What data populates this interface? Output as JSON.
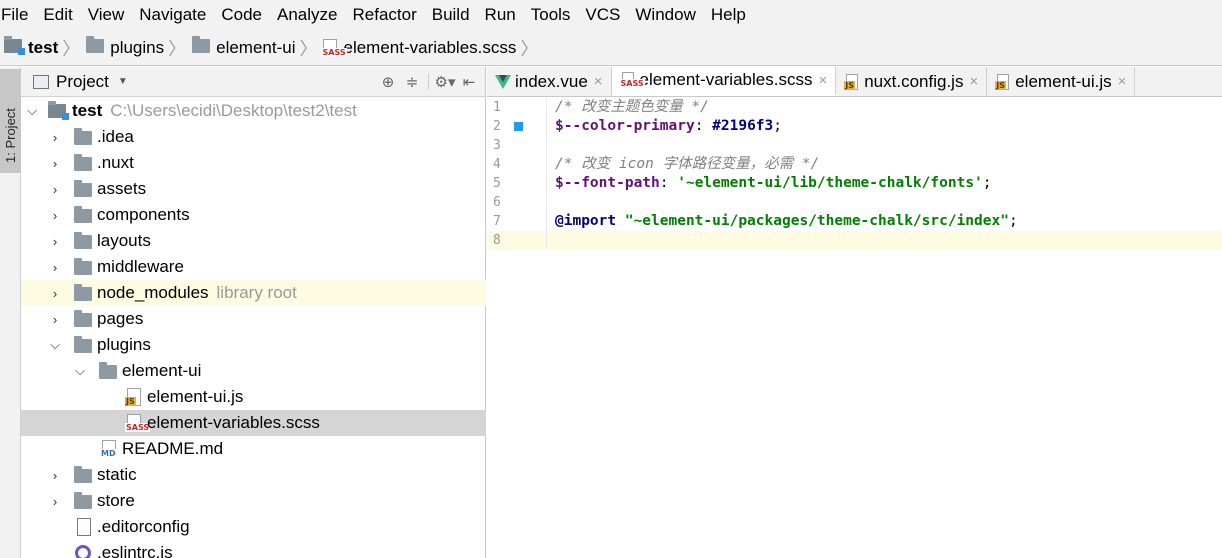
{
  "menu": [
    "File",
    "Edit",
    "View",
    "Navigate",
    "Code",
    "Analyze",
    "Refactor",
    "Build",
    "Run",
    "Tools",
    "VCS",
    "Window",
    "Help"
  ],
  "breadcrumb": [
    "test",
    "plugins",
    "element-ui",
    "element-variables.scss"
  ],
  "toolstrip": {
    "project_tab": "1: Project"
  },
  "panel": {
    "title": "Project"
  },
  "tree": [
    {
      "label": "test",
      "note": "C:\\Users\\ecidi\\Desktop\\test2\\test"
    },
    {
      "label": ".idea"
    },
    {
      "label": ".nuxt"
    },
    {
      "label": "assets"
    },
    {
      "label": "components"
    },
    {
      "label": "layouts"
    },
    {
      "label": "middleware"
    },
    {
      "label": "node_modules",
      "note": "library root"
    },
    {
      "label": "pages"
    },
    {
      "label": "plugins"
    },
    {
      "label": "element-ui"
    },
    {
      "label": "element-ui.js"
    },
    {
      "label": "element-variables.scss"
    },
    {
      "label": "README.md"
    },
    {
      "label": "static"
    },
    {
      "label": "store"
    },
    {
      "label": ".editorconfig"
    },
    {
      "label": ".eslintrc.js"
    }
  ],
  "tabs": [
    {
      "label": "index.vue"
    },
    {
      "label": "element-variables.scss"
    },
    {
      "label": "nuxt.config.js"
    },
    {
      "label": "element-ui.js"
    }
  ],
  "code": {
    "line_numbers": [
      "1",
      "2",
      "3",
      "4",
      "5",
      "6",
      "7",
      "8"
    ],
    "l1": "/* 改变主题色变量 */",
    "l2_var": "$--color-primary",
    "l2_colon": ": ",
    "l2_val": "#2196f3",
    "l2_end": ";",
    "l4": "/* 改变 icon 字体路径变量，必需 */",
    "l5_var": "$--font-path",
    "l5_colon": ": ",
    "l5_val": "'~element-ui/lib/theme-chalk/fonts'",
    "l5_end": ";",
    "l7_kw": "@import",
    "l7_sp": " ",
    "l7_val": "\"~element-ui/packages/theme-chalk/src/index\"",
    "l7_end": ";"
  },
  "colors": {
    "primary_marker": "#2196f3"
  }
}
